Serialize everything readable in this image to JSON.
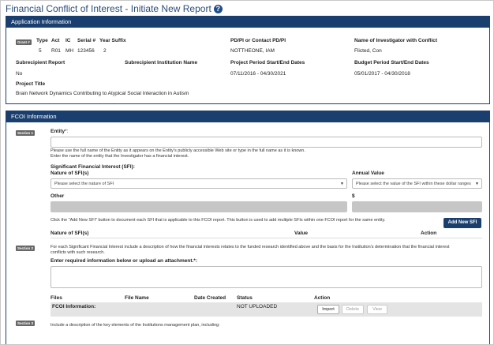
{
  "page": {
    "title": "Financial Conflict of Interest - Initiate New Report",
    "help_icon": "?"
  },
  "application": {
    "header": "Application Information",
    "grant_badge": "Grant #",
    "type_label": "Type",
    "type_value": "5",
    "act_label": "Act",
    "act_value": "R01",
    "ic_label": "IC",
    "ic_value": "MH",
    "serial_label": "Serial #",
    "serial_value": "123456",
    "suffix_label": "Year Suffix",
    "suffix_value": "2",
    "pd_label": "PD/PI or Contact PD/PI",
    "pd_value": "NOTTHEONE, IAM",
    "investigator_label": "Name of Investigator with Conflict",
    "investigator_value": "Flicted, Con",
    "subrecipient_label": "Subrecipient Report",
    "subrecipient_value": "No",
    "sub_inst_label": "Subrecipient Institution Name",
    "project_period_label": "Project Period Start/End Dates",
    "project_period_value": "07/11/2016 - 04/30/2021",
    "budget_period_label": "Budget Period Start/End Dates",
    "budget_period_value": "05/01/2017 - 04/30/2018",
    "project_title_label": "Project Title",
    "project_title_value": "Brain Network Dynamics Contributing to Atypical Social Interaction in Autism"
  },
  "fcoi": {
    "header": "FCOI Information",
    "section1": "Section 1",
    "entity_label": "Entity",
    "entity_required": "*:",
    "entity_help1": "Please use the full name of the Entity as it appears on the Entity's publicly accessible Web site or type in the full name as it is known.",
    "entity_help2": "Enter the name of the entity that the Investigator has a financial interest.",
    "sfi_label": "Significant Financial Interest (SFI):",
    "nature_label": "Nature of SFI(s)",
    "nature_placeholder": "Please select the nature of SFI",
    "annual_label": "Annual Value",
    "annual_placeholder": "Please select the value of the SFI within these dollar ranges",
    "other_label": "Other",
    "dollar_label": "$",
    "add_help": "Click the \"Add New SFI\" button to document each SFI that is applicable to this FCOI report. This button is used to add multiple SFIs within one FCOI report for the same entity.",
    "add_button": "Add New SFI",
    "col_nature": "Nature of SFI(s)",
    "col_value": "Value",
    "col_action": "Action",
    "section2": "Section 2",
    "section2_text": "For each Significant Financial Interest include a description of how the financial interests relates to the funded research identified above and the basis for the Institution's determination that the financial interest conflicts with such research.",
    "required_label": "Enter required information below or upload an attachment.",
    "required_star": "*:",
    "files_label": "Files",
    "file_name_label": "File Name",
    "date_created_label": "Date Created",
    "status_label": "Status",
    "action_label": "Action",
    "fcoi_info_label": "FCOI Information:",
    "status_value": "NOT UPLOADED",
    "import_button": "Import",
    "delete_button": "Delete",
    "view_button": "View",
    "section3": "Section 3",
    "section3_text": "Include a description of the key elements of the Institutions management plan, including:"
  }
}
